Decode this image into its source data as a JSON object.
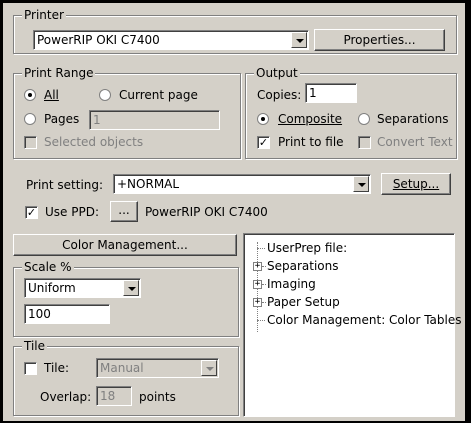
{
  "printer": {
    "legend": "Printer",
    "selected": "PowerRIP OKI C7400",
    "properties_label": "Properties..."
  },
  "print_range": {
    "legend": "Print Range",
    "all_label": "All",
    "current_page_label": "Current page",
    "pages_label": "Pages",
    "pages_value": "1",
    "selected_objects_label": "Selected objects",
    "selected": "All"
  },
  "output": {
    "legend": "Output",
    "copies_label": "Copies:",
    "copies_value": "1",
    "composite_label": "Composite",
    "separations_label": "Separations",
    "print_to_file_label": "Print to file",
    "print_to_file_checked": true,
    "convert_text_label": "Convert Text"
  },
  "print_setting": {
    "label": "Print setting:",
    "value": "+NORMAL",
    "setup_label": "Setup..."
  },
  "ppd": {
    "label": "Use PPD:",
    "checked": true,
    "browse_label": "...",
    "value": "PowerRIP OKI C7400"
  },
  "color_management_label": "Color Management...",
  "scale": {
    "legend": "Scale %",
    "mode": "Uniform",
    "value": "100"
  },
  "tile": {
    "legend": "Tile",
    "tile_label": "Tile:",
    "tile_mode": "Manual",
    "overlap_label": "Overlap:",
    "overlap_value": "18",
    "overlap_unit": "points"
  },
  "tree": {
    "items": [
      {
        "label": "UserPrep file:",
        "expandable": false
      },
      {
        "label": "Separations",
        "expandable": true
      },
      {
        "label": "Imaging",
        "expandable": true
      },
      {
        "label": "Paper Setup",
        "expandable": true
      },
      {
        "label": "Color Management: Color Tables",
        "expandable": false
      }
    ]
  }
}
